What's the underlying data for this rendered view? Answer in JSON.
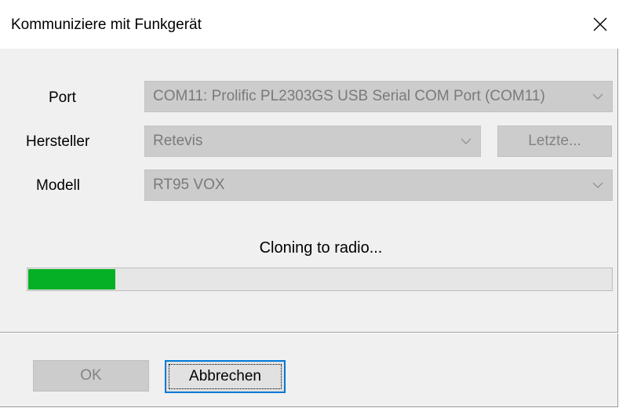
{
  "window": {
    "title": "Kommuniziere mit Funkgerät",
    "close_icon": "close-icon"
  },
  "form": {
    "port_label": "Port",
    "port_value": "COM11: Prolific PL2303GS USB Serial COM Port (COM11)",
    "manufacturer_label": "Hersteller",
    "manufacturer_value": "Retevis",
    "recent_button": "Letzte...",
    "model_label": "Modell",
    "model_value": "RT95 VOX"
  },
  "progress": {
    "status": "Cloning to radio...",
    "fraction": 0.15,
    "color": "#06b025"
  },
  "buttons": {
    "ok": "OK",
    "cancel": "Abbrechen"
  }
}
